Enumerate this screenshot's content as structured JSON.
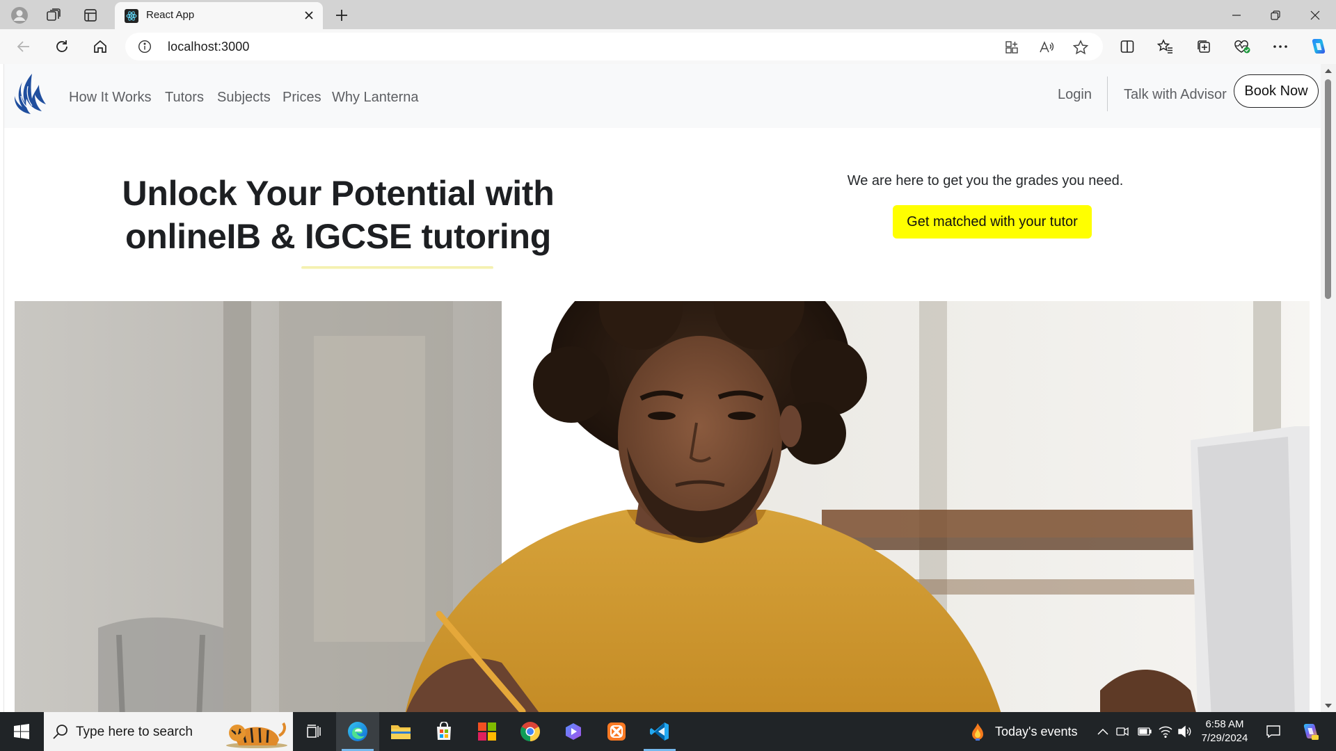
{
  "browser": {
    "tab_title": "React App",
    "url": "localhost:3000",
    "new_tab_symbol": "+"
  },
  "navbar": {
    "links": [
      "How It Works",
      "Tutors",
      "Subjects",
      "Prices",
      "Why Lanterna"
    ],
    "login": "Login",
    "advisor": "Talk with Advisor",
    "book_now": "Book Now"
  },
  "hero": {
    "title_line1": "Unlock Your Potential with",
    "title_line2": "onlineIB & IGCSE tutoring",
    "tagline": "We are here to get you the grades you need.",
    "cta": "Get matched with your tutor"
  },
  "taskbar": {
    "search_placeholder": "Type here to search",
    "events": "Today's events",
    "time": "6:58 AM",
    "date": "7/29/2024"
  },
  "colors": {
    "cta_yellow": "#ffff00",
    "logo_blue": "#1f4e9e",
    "navbar_bg": "#f8f9fa",
    "taskbar_bg": "#202427"
  },
  "icons": [
    "profile-icon",
    "workspaces-icon",
    "tab-actions-icon",
    "react-favicon-icon",
    "close-icon",
    "new-tab-icon",
    "minimize-icon",
    "restore-icon",
    "window-close-icon",
    "back-icon",
    "refresh-icon",
    "home-icon",
    "info-icon",
    "app-available-icon",
    "read-aloud-icon",
    "favorite-star-icon",
    "split-screen-icon",
    "favorites-icon",
    "collections-icon",
    "browser-essentials-icon",
    "more-icon",
    "copilot-icon",
    "windows-start-icon",
    "search-icon",
    "task-view-icon",
    "edge-icon",
    "file-explorer-icon",
    "store-icon",
    "office-icon",
    "chrome-icon",
    "copilot-app-icon",
    "xampp-icon",
    "vscode-icon",
    "weather-icon",
    "chevron-up-icon",
    "meet-icon",
    "battery-icon",
    "network-icon",
    "volume-icon",
    "notification-icon",
    "copilot-taskbar-icon"
  ]
}
